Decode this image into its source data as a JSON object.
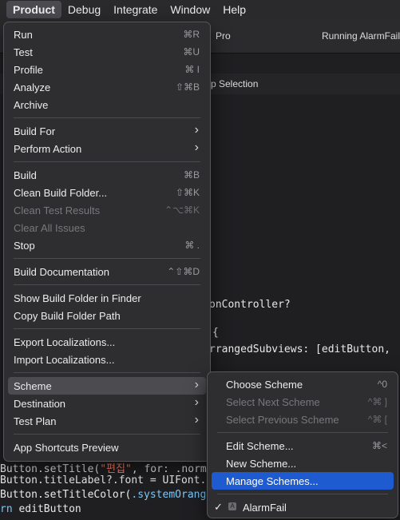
{
  "menubar": {
    "items": [
      "Product",
      "Debug",
      "Integrate",
      "Window",
      "Help"
    ],
    "active": "Product"
  },
  "background": {
    "scheme_fragment": "Pro",
    "status": "Running AlarmFail",
    "jumpbar": "p Selection",
    "code_lines": {
      "l1": "onController?",
      "l2": "{",
      "l3a": "rrangedSubviews: [",
      "l3b": "editButton, ",
      "l4a": "Button.setTitle(",
      "l4b": "\"편집\"",
      "l4c": ", for: .norm",
      "l5": "Button.titleLabel?.font = UIFont.",
      "l6a": "Button.setTitleColor(",
      "l6b": ".systemOrang",
      "l7a": "rn",
      "l7b": " editButton"
    }
  },
  "product_menu": {
    "run": {
      "label": "Run",
      "shortcut": "⌘R"
    },
    "test": {
      "label": "Test",
      "shortcut": "⌘U"
    },
    "profile": {
      "label": "Profile",
      "shortcut": "⌘ I"
    },
    "analyze": {
      "label": "Analyze",
      "shortcut": "⇧⌘B"
    },
    "archive": {
      "label": "Archive"
    },
    "build_for": {
      "label": "Build For"
    },
    "perform_action": {
      "label": "Perform Action"
    },
    "build": {
      "label": "Build",
      "shortcut": "⌘B"
    },
    "clean_build_folder": {
      "label": "Clean Build Folder...",
      "shortcut": "⇧⌘K"
    },
    "clean_test_results": {
      "label": "Clean Test Results",
      "shortcut": "⌃⌥⌘K"
    },
    "clear_all_issues": {
      "label": "Clear All Issues"
    },
    "stop": {
      "label": "Stop",
      "shortcut": "⌘ ."
    },
    "build_documentation": {
      "label": "Build Documentation",
      "shortcut": "⌃⇧⌘D"
    },
    "show_build_folder": {
      "label": "Show Build Folder in Finder"
    },
    "copy_build_folder_path": {
      "label": "Copy Build Folder Path"
    },
    "export_localizations": {
      "label": "Export Localizations..."
    },
    "import_localizations": {
      "label": "Import Localizations..."
    },
    "scheme": {
      "label": "Scheme"
    },
    "destination": {
      "label": "Destination"
    },
    "test_plan": {
      "label": "Test Plan"
    },
    "app_shortcuts_preview": {
      "label": "App Shortcuts Preview"
    }
  },
  "scheme_menu": {
    "choose_scheme": {
      "label": "Choose Scheme",
      "shortcut": "^0"
    },
    "select_next_scheme": {
      "label": "Select Next Scheme",
      "shortcut": "^⌘ ]"
    },
    "select_previous_scheme": {
      "label": "Select Previous Scheme",
      "shortcut": "^⌘ ["
    },
    "edit_scheme": {
      "label": "Edit Scheme...",
      "shortcut": "⌘<"
    },
    "new_scheme": {
      "label": "New Scheme..."
    },
    "manage_schemes": {
      "label": "Manage Schemes..."
    },
    "alarmfail": {
      "label": "AlarmFail",
      "checked": true
    }
  },
  "icons": {
    "submenu_arrow": "chevron-right-icon",
    "checkmark": "checkmark-icon",
    "app": "app-icon"
  },
  "colors": {
    "selection": "#1f5bd0",
    "menu_bg": "#2e2e31"
  }
}
